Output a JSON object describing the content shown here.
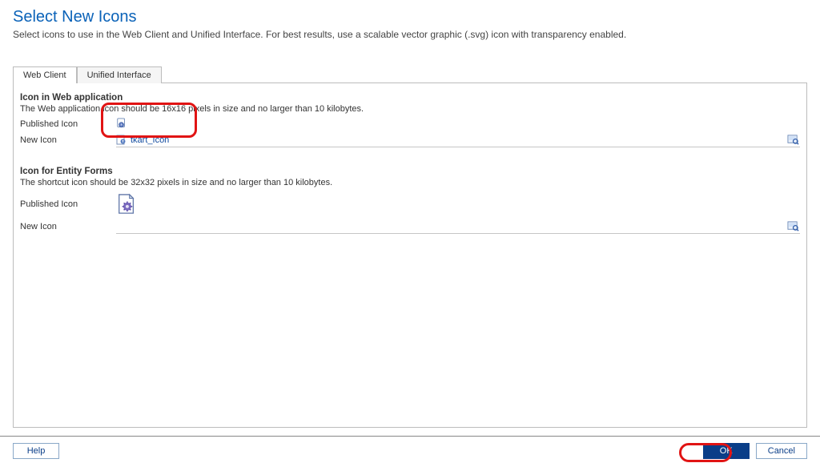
{
  "header": {
    "title": "Select New Icons",
    "subtitle": "Select icons to use in the Web Client and Unified Interface. For best results, use a scalable vector graphic (.svg) icon with transparency enabled."
  },
  "tabs": {
    "web_client": "Web Client",
    "unified_interface": "Unified Interface"
  },
  "section_web": {
    "title": "Icon in Web application",
    "desc": "The Web application icon should be 16x16 pixels in size and no larger than 10 kilobytes.",
    "published_label": "Published Icon",
    "new_label": "New Icon",
    "new_value": "tkart_Icon"
  },
  "section_forms": {
    "title": "Icon for Entity Forms",
    "desc": "The shortcut icon should be 32x32 pixels in size and no larger than 10 kilobytes.",
    "published_label": "Published Icon",
    "new_label": "New Icon",
    "new_value": ""
  },
  "buttons": {
    "help": "Help",
    "ok": "OK",
    "cancel": "Cancel"
  }
}
